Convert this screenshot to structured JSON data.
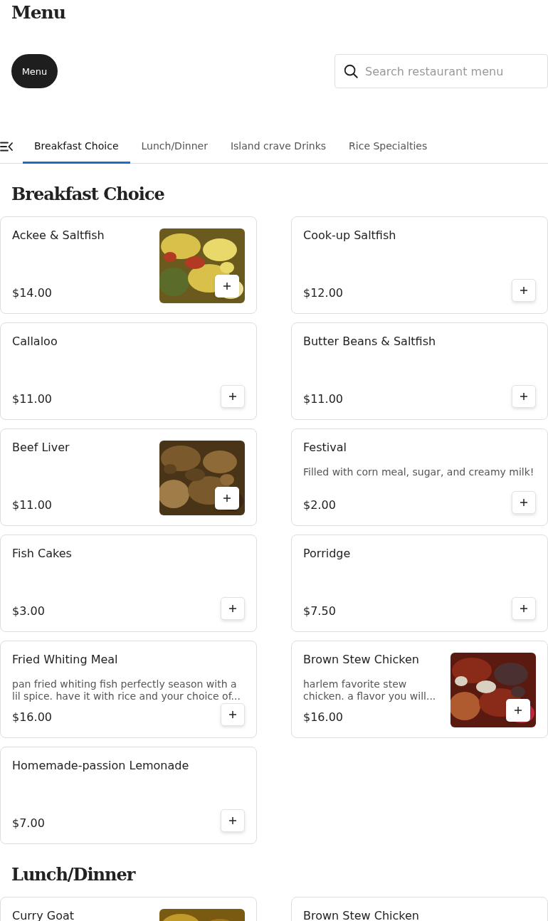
{
  "page_title": "Menu",
  "menu_button": "Menu",
  "search": {
    "placeholder": "Search restaurant menu"
  },
  "tabs": [
    {
      "label": "Breakfast Choice",
      "selected": true
    },
    {
      "label": "Lunch/Dinner",
      "selected": false
    },
    {
      "label": "Island crave Drinks",
      "selected": false
    },
    {
      "label": "Rice Specialties",
      "selected": false
    }
  ],
  "sections": [
    {
      "title": "Breakfast Choice",
      "items": [
        {
          "name": "Ackee & Saltfish",
          "price": "$14.00"
        },
        {
          "name": "Cook-up Saltfish",
          "price": "$12.00"
        },
        {
          "name": "Callaloo",
          "price": "$11.00"
        },
        {
          "name": "Butter Beans & Saltfish",
          "price": "$11.00"
        },
        {
          "name": "Beef Liver",
          "price": "$11.00"
        },
        {
          "name": "Festival",
          "description": "Filled with corn meal, sugar, and creamy milk!",
          "price": "$2.00"
        },
        {
          "name": "Fish Cakes",
          "price": "$3.00"
        },
        {
          "name": "Porridge",
          "price": "$7.50"
        },
        {
          "name": "Fried Whiting Meal",
          "description": "pan fried whiting fish perfectly season with a lil spice. have it with rice and your choice of...",
          "price": "$16.00"
        },
        {
          "name": "Brown Stew Chicken",
          "description": "harlem favorite stew chicken. a flavor you will...",
          "price": "$16.00"
        },
        {
          "name": "Homemade-passion Lemonade",
          "price": "$7.00"
        }
      ]
    },
    {
      "title": "Lunch/Dinner",
      "items": [
        {
          "name": "Curry Goat"
        },
        {
          "name": "Brown Stew Chicken"
        }
      ]
    }
  ]
}
